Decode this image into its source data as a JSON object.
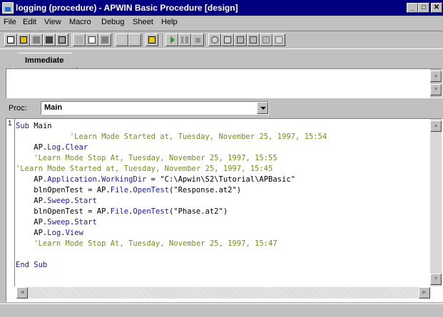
{
  "window": {
    "title": "logging (procedure) - APWIN Basic Procedure [design]",
    "controls": [
      "_",
      "□",
      "✕"
    ]
  },
  "menu": [
    "File",
    "Edit",
    "View",
    "Macro",
    "Debug",
    "Sheet",
    "Help"
  ],
  "toolbar": {
    "icons": [
      "new-icon",
      "open-icon",
      "save-icon",
      "save-all-icon",
      "print-icon",
      "cut-icon",
      "copy-icon",
      "paste-icon",
      "undo-icon",
      "redo-icon",
      "dialog-editor-icon",
      "run-icon",
      "pause-icon",
      "stop-icon",
      "toggle-breakpoint-icon",
      "quick-watch-icon",
      "step-into-icon",
      "step-over-icon",
      "step-out-icon",
      "calls-icon"
    ]
  },
  "tabs": {
    "immediate": "Immediate"
  },
  "proc": {
    "label": "Proc:",
    "value": "Main"
  },
  "editor": {
    "line_number": "1",
    "lines": [
      [
        {
          "t": "Sub ",
          "c": "kw"
        },
        {
          "t": "Main",
          "c": "obj"
        }
      ],
      [
        {
          "t": "            'Learn Mode Started at, Tuesday, November 25, 1997, 15:54",
          "c": "cmt"
        }
      ],
      [
        {
          "t": "    AP.",
          "c": "obj"
        },
        {
          "t": "Log",
          "c": "mem"
        },
        {
          "t": ".",
          "c": "obj"
        },
        {
          "t": "Clear",
          "c": "mem"
        }
      ],
      [
        {
          "t": "    'Learn Mode Stop At, Tuesday, November 25, 1997, 15:55",
          "c": "cmt"
        }
      ],
      [
        {
          "t": "'Learn Mode Started at, Tuesday, November 25, 1997, 15:45",
          "c": "cmt"
        }
      ],
      [
        {
          "t": "    AP.",
          "c": "obj"
        },
        {
          "t": "Application",
          "c": "mem"
        },
        {
          "t": ".",
          "c": "obj"
        },
        {
          "t": "WorkingDir",
          "c": "mem"
        },
        {
          "t": " = \"C:\\Apwin\\S2\\Tutorial\\APBasic\"",
          "c": "obj"
        }
      ],
      [
        {
          "t": "    blnOpenTest = AP.",
          "c": "obj"
        },
        {
          "t": "File",
          "c": "mem"
        },
        {
          "t": ".",
          "c": "obj"
        },
        {
          "t": "OpenTest",
          "c": "mem"
        },
        {
          "t": "(\"Response.at2\")",
          "c": "obj"
        }
      ],
      [
        {
          "t": "    AP.",
          "c": "obj"
        },
        {
          "t": "Sweep",
          "c": "mem"
        },
        {
          "t": ".",
          "c": "obj"
        },
        {
          "t": "Start",
          "c": "mem"
        }
      ],
      [
        {
          "t": "    blnOpenTest = AP.",
          "c": "obj"
        },
        {
          "t": "File",
          "c": "mem"
        },
        {
          "t": ".",
          "c": "obj"
        },
        {
          "t": "OpenTest",
          "c": "mem"
        },
        {
          "t": "(\"Phase.at2\")",
          "c": "obj"
        }
      ],
      [
        {
          "t": "    AP.",
          "c": "obj"
        },
        {
          "t": "Sweep",
          "c": "mem"
        },
        {
          "t": ".",
          "c": "obj"
        },
        {
          "t": "Start",
          "c": "mem"
        }
      ],
      [
        {
          "t": "    AP.",
          "c": "obj"
        },
        {
          "t": "Log",
          "c": "mem"
        },
        {
          "t": ".",
          "c": "obj"
        },
        {
          "t": "View",
          "c": "mem"
        }
      ],
      [
        {
          "t": "    'Learn Mode Stop At, Tuesday, November 25, 1997, 15:47",
          "c": "cmt"
        }
      ],
      [
        {
          "t": "",
          "c": "obj"
        }
      ],
      [
        {
          "t": "End Sub",
          "c": "kw"
        }
      ]
    ]
  },
  "colors": {
    "titlebar": "#000080",
    "keyword": "#1a1aa8",
    "comment": "#7a8c1a",
    "chrome": "#c0c0c0"
  }
}
